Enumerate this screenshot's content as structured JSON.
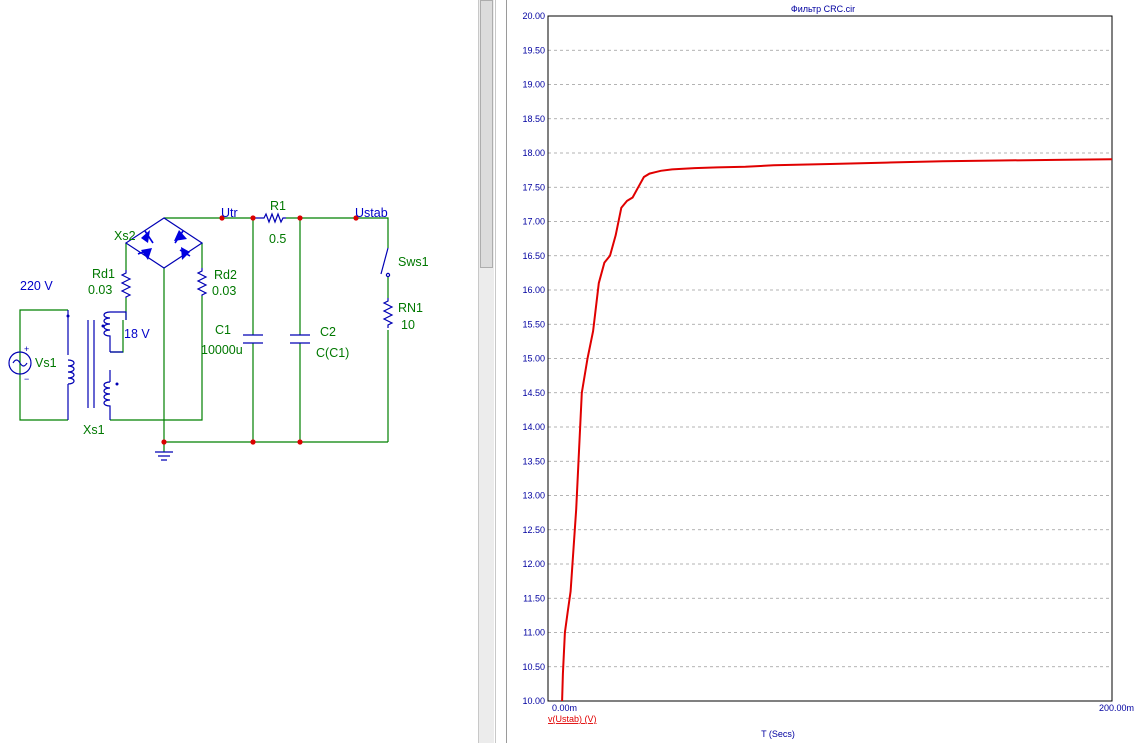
{
  "schematic": {
    "labels": {
      "utr": "Utr",
      "r1_name": "R1",
      "r1_value": "0.5",
      "ustab": "Ustab",
      "xs2": "Xs2",
      "sws1": "Sws1",
      "rd1_name": "Rd1",
      "rd1_value": "0.03",
      "rd2_name": "Rd2",
      "rd2_value": "0.03",
      "source_voltage": "220 V",
      "rn1_name": "RN1",
      "rn1_value": "10",
      "secondary_voltage": "18 V",
      "c1_name": "C1",
      "c1_value": "10000u",
      "c2_name": "C2",
      "c2_value": "C(C1)",
      "vs1": "Vs1",
      "xs1": "Xs1",
      "plus": "+",
      "minus": "−"
    },
    "colors": {
      "wire": "#008000",
      "component": "#0000b4",
      "node": "#dc0000",
      "net_label": "#0000c8"
    }
  },
  "plot": {
    "title": "Фильтр CRC.cir",
    "x_axis_label": "T (Secs)",
    "trace_label": "v(Ustab) (V)",
    "trace_color": "#e00000",
    "axis_color": "#0000a0"
  },
  "chart_data": {
    "type": "line",
    "title": "Фильтр CRC.cir",
    "xlabel": "T (Secs)",
    "ylabel": "",
    "xlim": [
      0,
      200
    ],
    "ylim": [
      10,
      20
    ],
    "x_tick_labels": [
      "0.00m",
      "200.00m"
    ],
    "y_ticks": [
      10.0,
      10.5,
      11.0,
      11.5,
      12.0,
      12.5,
      13.0,
      13.5,
      14.0,
      14.5,
      15.0,
      15.5,
      16.0,
      16.5,
      17.0,
      17.5,
      18.0,
      18.5,
      19.0,
      19.5,
      20.0
    ],
    "y_tick_labels": [
      "10.00",
      "10.50",
      "11.00",
      "11.50",
      "12.00",
      "12.50",
      "13.00",
      "13.50",
      "14.00",
      "14.50",
      "15.00",
      "15.50",
      "16.00",
      "16.50",
      "17.00",
      "17.50",
      "18.00",
      "18.50",
      "19.00",
      "19.50",
      "20.00"
    ],
    "grid": true,
    "series": [
      {
        "name": "v(Ustab) (V)",
        "x": [
          5,
          5.3,
          6,
          7,
          8,
          9,
          10,
          12,
          14,
          16,
          18,
          20,
          22,
          24,
          26,
          28,
          30,
          32,
          34,
          36,
          38,
          40,
          44,
          48,
          52,
          60,
          70,
          80,
          100,
          120,
          140,
          160,
          180,
          200
        ],
        "y": [
          10.0,
          10.4,
          11.0,
          11.3,
          11.6,
          12.2,
          12.8,
          14.5,
          15.0,
          15.4,
          16.1,
          16.4,
          16.5,
          16.8,
          17.2,
          17.3,
          17.35,
          17.5,
          17.65,
          17.7,
          17.72,
          17.74,
          17.76,
          17.77,
          17.78,
          17.79,
          17.8,
          17.82,
          17.84,
          17.86,
          17.88,
          17.89,
          17.9,
          17.91
        ]
      }
    ]
  }
}
